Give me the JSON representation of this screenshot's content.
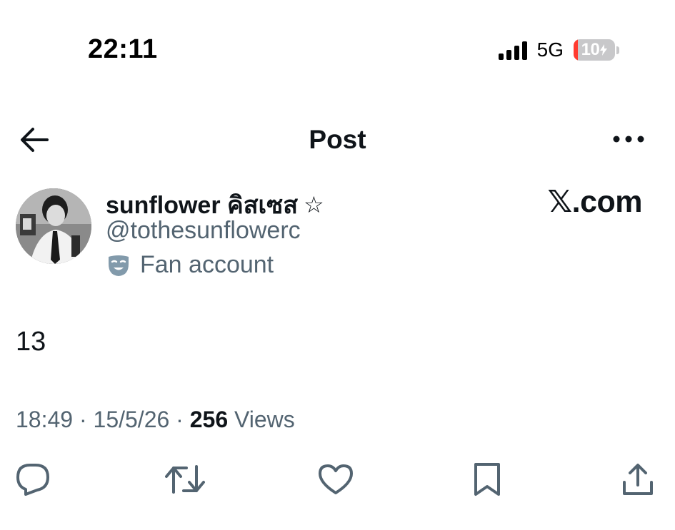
{
  "status_bar": {
    "time": "22:11",
    "network": "5G",
    "battery_level": "10",
    "battery_fraction": 0.1,
    "signal_bars": 4
  },
  "nav": {
    "title": "Post",
    "back_icon": "arrow-left-icon",
    "more_icon": "more-horizontal-icon"
  },
  "author": {
    "display_name": "sunflower คิสเซส",
    "name_suffix": "☆",
    "handle": "@tothesunflowerc",
    "badge_label": "Fan account",
    "badge_icon": "theater-masks-icon"
  },
  "watermark": "𝕏.com",
  "post": {
    "text": "13",
    "time": "18:49",
    "date": "15/5/26",
    "views_count": "256",
    "views_label": "Views",
    "separator": "·"
  },
  "actions": [
    {
      "name": "reply",
      "icon": "reply-icon"
    },
    {
      "name": "repost",
      "icon": "repost-icon"
    },
    {
      "name": "like",
      "icon": "heart-icon"
    },
    {
      "name": "bookmark",
      "icon": "bookmark-icon"
    },
    {
      "name": "share",
      "icon": "share-icon"
    }
  ],
  "colors": {
    "text_primary": "#0f1419",
    "text_secondary": "#536471",
    "battery_low": "#ff3b30",
    "badge_icon": "#829aab"
  }
}
